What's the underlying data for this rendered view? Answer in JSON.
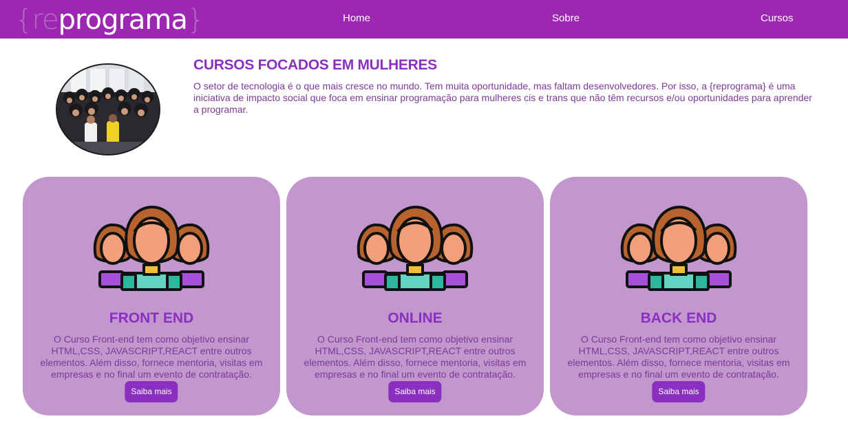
{
  "nav": {
    "logo": {
      "open_brace": "{",
      "prefix": "re",
      "name": "programa",
      "close_brace": "}"
    },
    "links": [
      "Home",
      "Sobre",
      "Cursos"
    ]
  },
  "intro": {
    "title": "CURSOS FOCADOS EM MULHERES",
    "text": "O setor de tecnologia é o que mais cresce no mundo. Tem muita oportunidade, mas faltam desenvolvedores. Por isso, a {reprograma} é uma iniciativa de impacto social que foca em ensinar programação para mulheres cis e trans que não têm recursos e/ou oportunidades para aprender a programar."
  },
  "cards": [
    {
      "title": "FRONT END",
      "description": "O Curso Front-end tem como objetivo ensinar HTML,CSS, JAVASCRIPT,REACT entre outros elementos. Além disso, fornece mentoria, visitas em empresas e no final um evento de contratação.",
      "button": "Saiba mais"
    },
    {
      "title": "ONLINE",
      "description": "O Curso Front-end tem como objetivo ensinar HTML,CSS, JAVASCRIPT,REACT entre outros elementos. Além disso, fornece mentoria, visitas em empresas e no final um evento de contratação.",
      "button": "Saiba mais"
    },
    {
      "title": "BACK END",
      "description": "O Curso Front-end tem como objetivo ensinar HTML,CSS, JAVASCRIPT,REACT entre outros elementos. Além disso, fornece mentoria, visitas em empresas e no final um evento de contratação.",
      "button": "Saiba mais"
    }
  ],
  "colors": {
    "nav_bg": "#9c27b0",
    "accent": "#8a2fc0",
    "card_bg": "#c297cd",
    "body_text": "#7b3a95"
  },
  "icons": {
    "card_illustration": "women-group-icon",
    "intro_photo": "group-photo"
  }
}
